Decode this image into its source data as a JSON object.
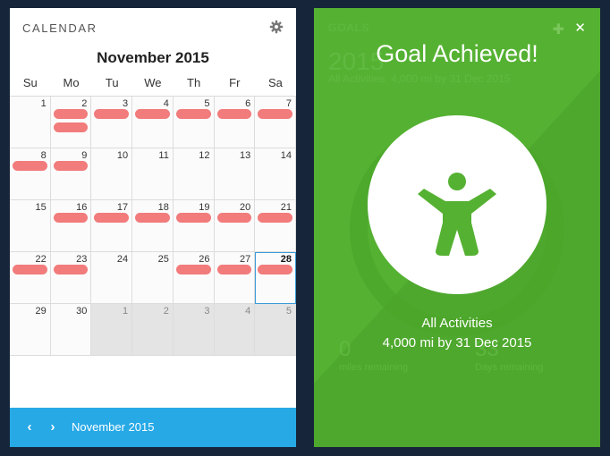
{
  "calendar": {
    "title": "CALENDAR",
    "month_title": "November 2015",
    "weekdays": [
      "Su",
      "Mo",
      "Tu",
      "We",
      "Th",
      "Fr",
      "Sa"
    ],
    "weeks": [
      [
        {
          "n": "1",
          "pills": 0
        },
        {
          "n": "2",
          "pills": 2
        },
        {
          "n": "3",
          "pills": 1
        },
        {
          "n": "4",
          "pills": 1
        },
        {
          "n": "5",
          "pills": 1
        },
        {
          "n": "6",
          "pills": 1
        },
        {
          "n": "7",
          "pills": 1
        }
      ],
      [
        {
          "n": "8",
          "pills": 1
        },
        {
          "n": "9",
          "pills": 1
        },
        {
          "n": "10",
          "pills": 0
        },
        {
          "n": "11",
          "pills": 0
        },
        {
          "n": "12",
          "pills": 0
        },
        {
          "n": "13",
          "pills": 0
        },
        {
          "n": "14",
          "pills": 0
        }
      ],
      [
        {
          "n": "15",
          "pills": 0
        },
        {
          "n": "16",
          "pills": 1
        },
        {
          "n": "17",
          "pills": 1
        },
        {
          "n": "18",
          "pills": 1
        },
        {
          "n": "19",
          "pills": 1
        },
        {
          "n": "20",
          "pills": 1
        },
        {
          "n": "21",
          "pills": 1
        }
      ],
      [
        {
          "n": "22",
          "pills": 1
        },
        {
          "n": "23",
          "pills": 1
        },
        {
          "n": "24",
          "pills": 0
        },
        {
          "n": "25",
          "pills": 0
        },
        {
          "n": "26",
          "pills": 1
        },
        {
          "n": "27",
          "pills": 1
        },
        {
          "n": "28",
          "pills": 1,
          "today": true
        }
      ],
      [
        {
          "n": "29",
          "pills": 0
        },
        {
          "n": "30",
          "pills": 0
        },
        {
          "n": "1",
          "pills": 0,
          "other": true
        },
        {
          "n": "2",
          "pills": 0,
          "other": true
        },
        {
          "n": "3",
          "pills": 0,
          "other": true
        },
        {
          "n": "4",
          "pills": 0,
          "other": true
        },
        {
          "n": "5",
          "pills": 0,
          "other": true
        }
      ]
    ],
    "footer_label": "November 2015",
    "prev_icon": "chevron-left-icon",
    "next_icon": "chevron-right-icon",
    "pill_color": "#f27b7b",
    "footer_color": "#27a9e6"
  },
  "goals": {
    "header_ghost": "GOALS",
    "year_ghost": "2015",
    "subtitle_ghost": "All Activities, 4,000 mi by 31 Dec 2015",
    "left_stat_ghost": "0",
    "left_stat_label_ghost": "miles remaining",
    "right_stat_ghost": "33",
    "right_stat_label_ghost": "Days remaining",
    "achieved_title": "Goal Achieved!",
    "activity_label": "All Activities",
    "activity_detail": "4,000 mi by 31 Dec 2015",
    "close_icon": "close-icon",
    "plus_icon": "plus-icon",
    "badge_icon": "person-celebrating-icon",
    "accent_color": "#55b132"
  }
}
